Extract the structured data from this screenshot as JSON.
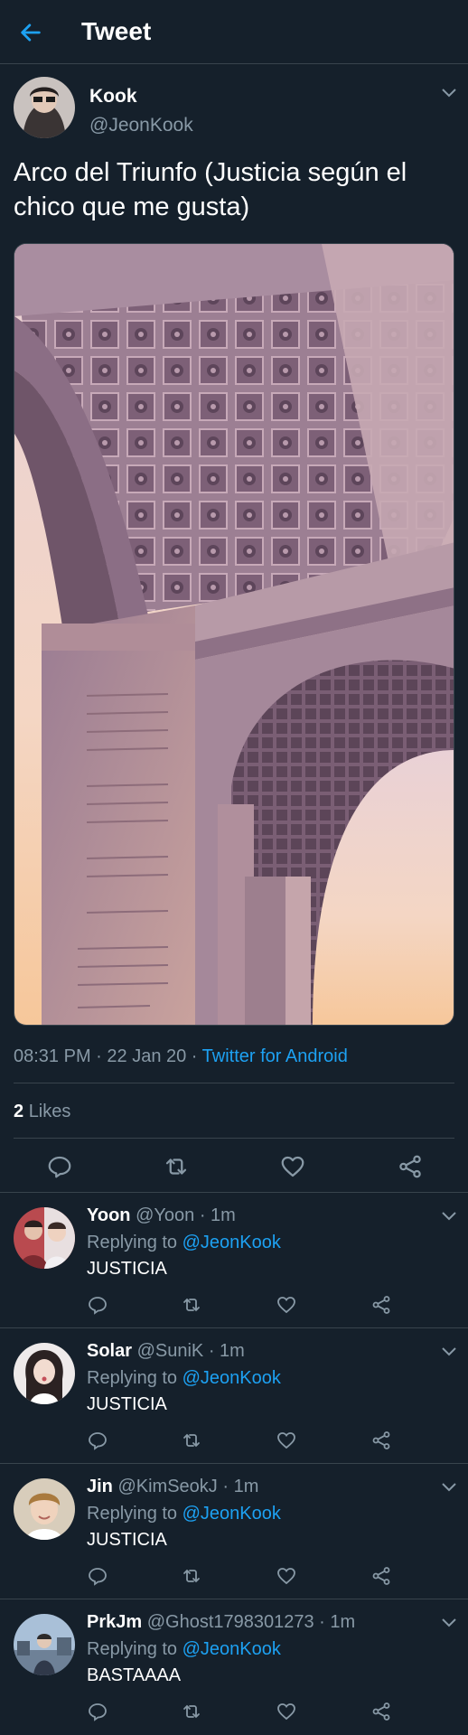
{
  "header": {
    "title": "Tweet",
    "back_icon": "arrow-left-icon",
    "accent": "#1da1f2"
  },
  "tweet": {
    "author_name": "Kook",
    "author_handle": "@JeonKook",
    "text": "Arco del Triunfo (Justicia según el chico que me gusta)",
    "time": "08:31 PM",
    "date": "22 Jan 20",
    "source": "Twitter for Android",
    "likes_count": "2",
    "likes_label": "Likes"
  },
  "replies": [
    {
      "name": "Yoon",
      "handle": "@Yoon",
      "time": "1m",
      "replying_label": "Replying to",
      "replying_to": "@JeonKook",
      "text": "JUSTICIA"
    },
    {
      "name": "Solar",
      "handle": "@SuniK",
      "time": "1m",
      "replying_label": "Replying to",
      "replying_to": "@JeonKook",
      "text": "JUSTICIA"
    },
    {
      "name": "Jin",
      "handle": "@KimSeokJ",
      "time": "1m",
      "replying_label": "Replying to",
      "replying_to": "@JeonKook",
      "text": "JUSTICIA"
    },
    {
      "name": "PrkJm",
      "handle": "@Ghost1798301273",
      "time": "1m",
      "replying_label": "Replying to",
      "replying_to": "@JeonKook",
      "text": "BASTAAAA"
    }
  ],
  "colors": {
    "background": "#15202b",
    "divider": "#38444d",
    "muted": "#8899a6",
    "link": "#1da1f2"
  }
}
